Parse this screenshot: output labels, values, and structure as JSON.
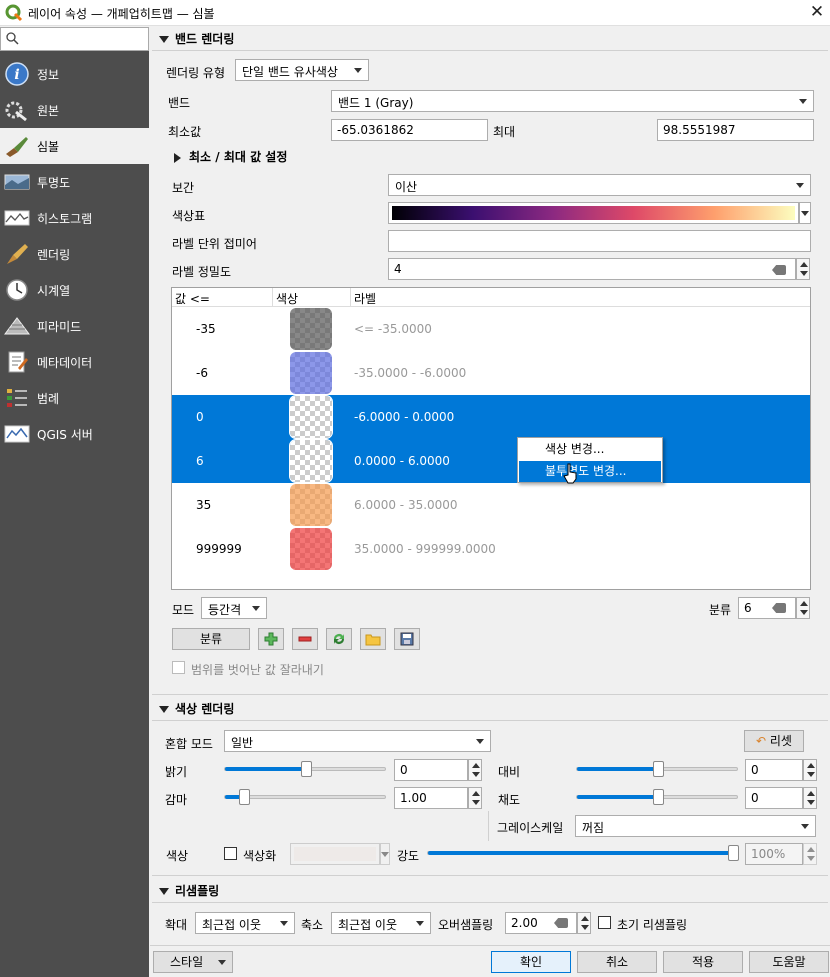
{
  "window": {
    "title": "레이어 속성 — 개페업히트맵 — 심볼",
    "close": "✕"
  },
  "sidebar": {
    "search_placeholder": "",
    "items": [
      {
        "label": "정보",
        "icon": "info-icon"
      },
      {
        "label": "원본",
        "icon": "source-wrench-icon"
      },
      {
        "label": "심볼",
        "icon": "symbology-brush-icon"
      },
      {
        "label": "투명도",
        "icon": "transparency-icon"
      },
      {
        "label": "히스토그램",
        "icon": "histogram-icon"
      },
      {
        "label": "렌더링",
        "icon": "rendering-brush-icon"
      },
      {
        "label": "시계열",
        "icon": "clock-icon"
      },
      {
        "label": "피라미드",
        "icon": "pyramid-icon"
      },
      {
        "label": "메타데이터",
        "icon": "metadata-icon"
      },
      {
        "label": "범례",
        "icon": "legend-icon"
      },
      {
        "label": "QGIS 서버",
        "icon": "server-icon"
      }
    ]
  },
  "band": {
    "section_title": "밴드 렌더링",
    "render_type_label": "렌더링 유형",
    "render_type_value": "단일 밴드 유사색상",
    "band_label": "밴드",
    "band_value": "밴드 1 (Gray)",
    "min_label": "최소값",
    "min_value": "-65.0361862",
    "max_label": "최대",
    "max_value": "98.5551987",
    "minmax_settings": "최소 / 최대 값 설정",
    "interp_label": "보간",
    "interp_value": "이산",
    "ramp_label": "색상표",
    "suffix_label": "라벨 단위 접미어",
    "suffix_value": "",
    "precision_label": "라벨 정밀도",
    "precision_value": "4",
    "table": {
      "headers": [
        "값 <=",
        "색상",
        "라벨"
      ],
      "rows": [
        {
          "value": "-35",
          "label": "<= -35.0000",
          "color": "#555555",
          "selected": false
        },
        {
          "value": "-6",
          "label": "-35.0000 - -6.0000",
          "color": "#5b6be0",
          "selected": false
        },
        {
          "value": "0",
          "label": "-6.0000 - 0.0000",
          "color": "#ffffff",
          "selected": true
        },
        {
          "value": "6",
          "label": "0.0000 - 6.0000",
          "color": "#ffffff",
          "selected": true
        },
        {
          "value": "35",
          "label": "6.0000 - 35.0000",
          "color": "#f59a4d",
          "selected": false
        },
        {
          "value": "999999",
          "label": "35.0000 - 999999.0000",
          "color": "#f03a3a",
          "selected": false
        }
      ]
    },
    "context_menu": [
      "색상 변경...",
      "불투명도 변경..."
    ],
    "mode_label": "모드",
    "mode_value": "등간격",
    "classes_label": "분류",
    "classes_value": "6",
    "classify_button": "분류",
    "clip_label": "범위를 벗어난 값 잘라내기"
  },
  "color": {
    "section_title": "색상 렌더링",
    "blend_label": "혼합 모드",
    "blend_value": "일반",
    "reset_button": "리셋",
    "brightness_label": "밝기",
    "brightness_value": "0",
    "brightness_level": 0.5,
    "contrast_label": "대비",
    "contrast_value": "0",
    "contrast_level": 0.5,
    "gamma_label": "감마",
    "gamma_value": "1.00",
    "gamma_level": 0.12,
    "saturation_label": "채도",
    "saturation_value": "0",
    "saturation_level": 0.5,
    "grayscale_label": "그레이스케일",
    "grayscale_value": "꺼짐",
    "hue_label": "색상",
    "colorize_label": "색상화",
    "strength_label": "강도",
    "strength_value": "100%",
    "strength_level": 1.0
  },
  "resample": {
    "section_title": "리샘플링",
    "zoomin_label": "확대",
    "zoomin_value": "최근접 이웃",
    "zoomout_label": "축소",
    "zoomout_value": "최근접 이웃",
    "oversample_label": "오버샘플링",
    "oversample_value": "2.00",
    "early_label": "초기 리샘플링"
  },
  "footer": {
    "style": "스타일",
    "ok": "확인",
    "cancel": "취소",
    "apply": "적용",
    "help": "도움말"
  },
  "colors": {
    "accent": "#0078d7",
    "sidebar_bg": "#4d4d4d"
  }
}
